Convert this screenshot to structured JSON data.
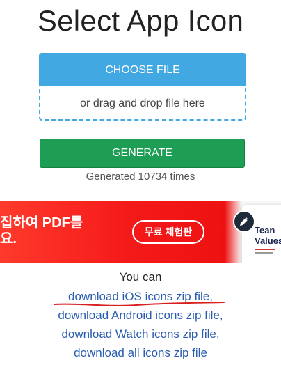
{
  "page": {
    "title": "Select App Icon"
  },
  "upload": {
    "choose_label": "CHOOSE FILE",
    "drop_hint": "or drag and drop file here"
  },
  "generate": {
    "label": "GENERATE",
    "count_text": "Generated 10734 times"
  },
  "ad": {
    "headline": "집하여 PDF를\n요.",
    "cta": "무료 체험판",
    "card_title": "Tean\nValues",
    "edit_icon": "pen-icon"
  },
  "downloads": {
    "intro": "You can",
    "links": [
      "download iOS icons zip file,",
      "download Android icons zip file,",
      "download Watch icons zip file,",
      "download all icons zip file"
    ]
  },
  "colors": {
    "accent_blue": "#42a8e2",
    "generate_green": "#1e9e55",
    "link_blue": "#2a5db0",
    "annotation_red": "#d91e1e"
  }
}
